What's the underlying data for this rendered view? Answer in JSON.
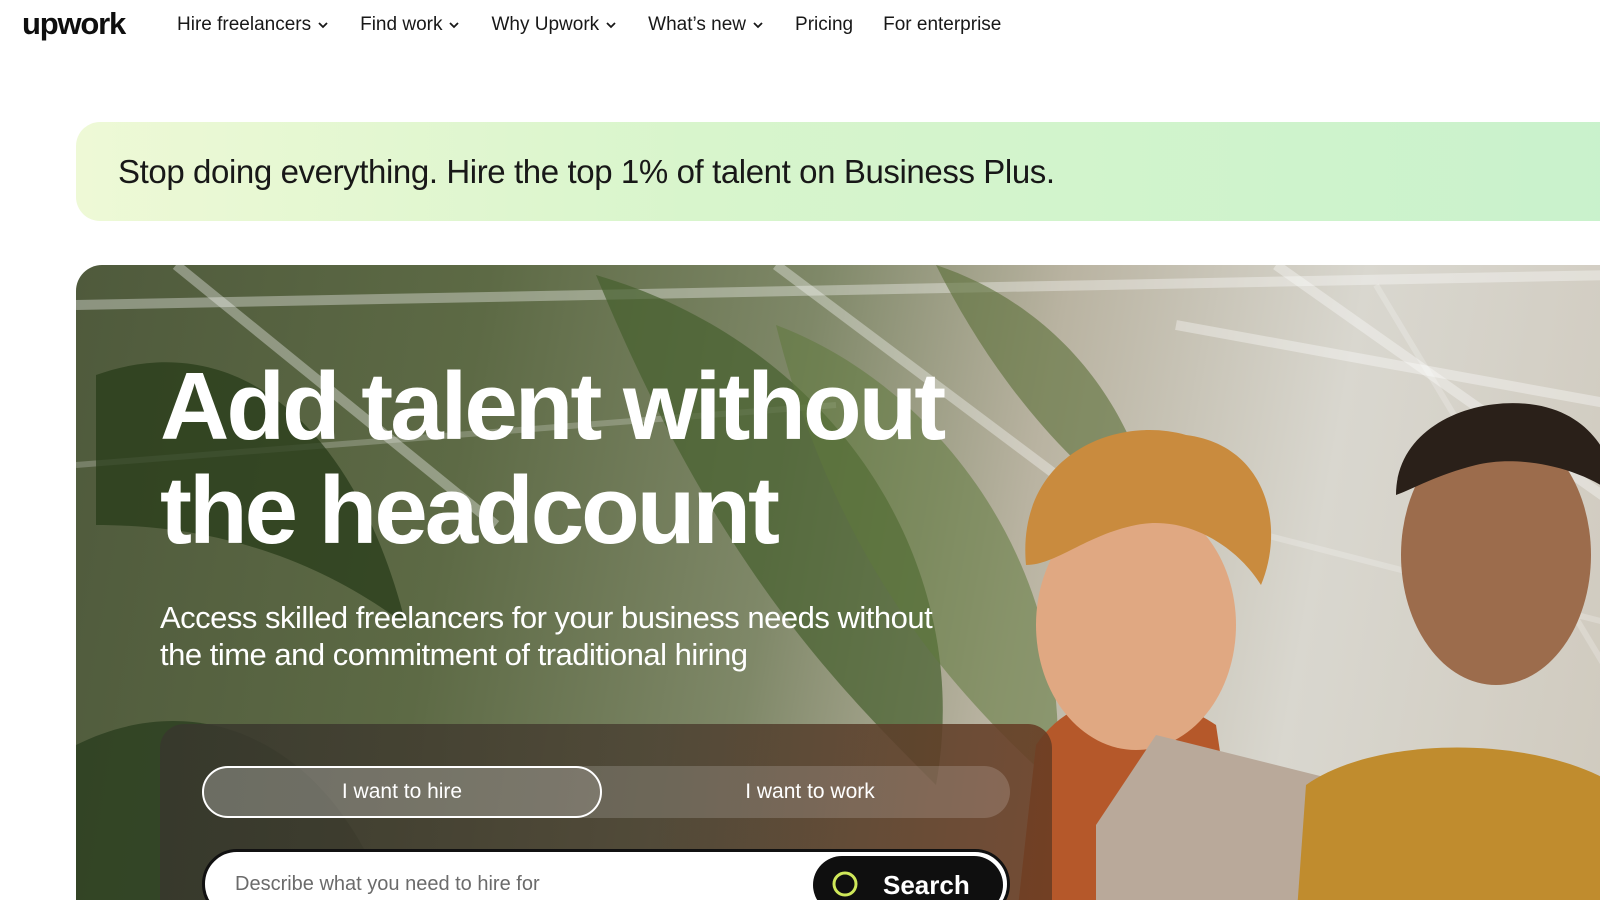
{
  "brand": {
    "logo_text": "upwork"
  },
  "nav": {
    "items": [
      {
        "label": "Hire freelancers",
        "has_dropdown": true
      },
      {
        "label": "Find work",
        "has_dropdown": true
      },
      {
        "label": "Why Upwork",
        "has_dropdown": true
      },
      {
        "label": "What’s new",
        "has_dropdown": true
      },
      {
        "label": "Pricing",
        "has_dropdown": false
      },
      {
        "label": "For enterprise",
        "has_dropdown": false
      }
    ]
  },
  "promo": {
    "text": "Stop doing everything. Hire the top 1% of talent on Business Plus."
  },
  "hero": {
    "title": "Add talent without the headcount",
    "subtitle": "Access skilled freelancers for your business needs without the time and commitment of traditional hiring"
  },
  "search_card": {
    "toggle": {
      "hire_label": "I want to hire",
      "work_label": "I want to work",
      "selected": "hire"
    },
    "input_placeholder": "Describe what you need to hire for",
    "search_label": "Search"
  },
  "colors": {
    "accent_green": "#14a800",
    "dark": "#0f0f0f",
    "promo_start": "#eef9d6",
    "promo_end": "#c9f2cc"
  }
}
